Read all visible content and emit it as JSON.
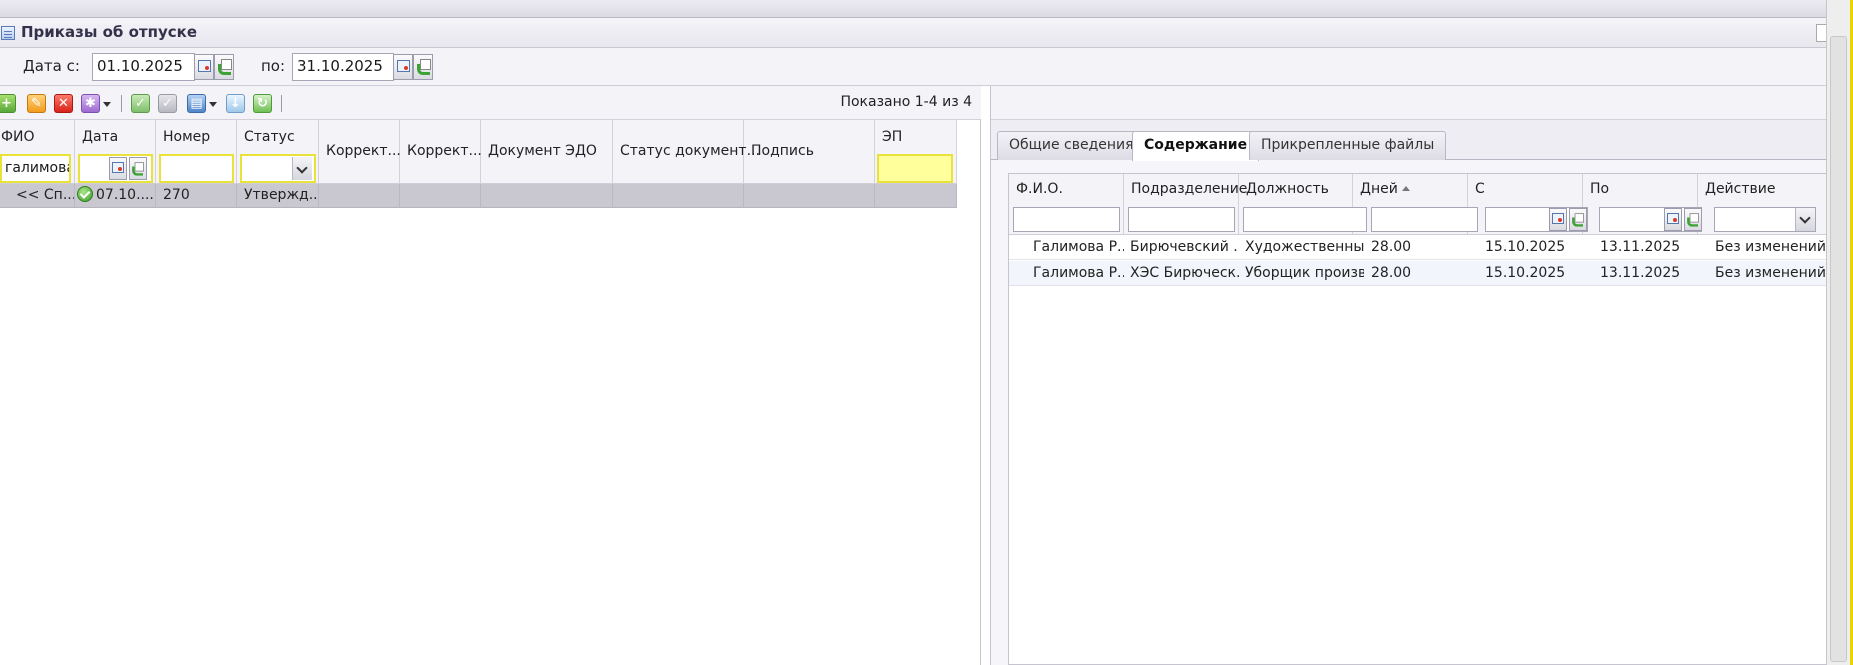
{
  "window": {
    "title": "Приказы об отпуске"
  },
  "filters": {
    "date_from_label": "Дата с:",
    "date_from": "01.10.2025",
    "date_to_label": "по:",
    "date_to": "31.10.2025"
  },
  "toolbar": {
    "shown_text": "Показано 1-4 из 4"
  },
  "orders_grid": {
    "columns": [
      "ФИО",
      "Дата",
      "Номер",
      "Статус",
      "Коррект...",
      "Коррект...",
      "Документ ЭДО",
      "Статус документ...",
      "Подпись",
      "ЭП"
    ],
    "filters": {
      "fio": "галимова"
    },
    "rows": [
      {
        "fio": "<< Сп...",
        "date": "07.10....",
        "number": "270",
        "status": "Утвержд...",
        "c5": "",
        "c6": "",
        "edo": "",
        "edo_status": "",
        "sign": "",
        "ep": ""
      }
    ]
  },
  "detail": {
    "tabs": [
      "Общие сведения",
      "Содержание",
      "Прикрепленные файлы"
    ],
    "active_tab": "Содержание",
    "columns": [
      "Ф.И.О.",
      "Подразделение",
      "Должность",
      "Дней",
      "С",
      "По",
      "Действие"
    ],
    "rows": [
      {
        "fio": "Галимова Р...",
        "dept": "Бирючевский ...",
        "position": "Художественный...",
        "days": "28.00",
        "from": "15.10.2025",
        "to": "13.11.2025",
        "action": "Без изменений"
      },
      {
        "fio": "Галимова Р...",
        "dept": "ХЭС Бирюческ...",
        "position": "Уборщик произв...",
        "days": "28.00",
        "from": "15.10.2025",
        "to": "13.11.2025",
        "action": "Без изменений"
      }
    ]
  }
}
